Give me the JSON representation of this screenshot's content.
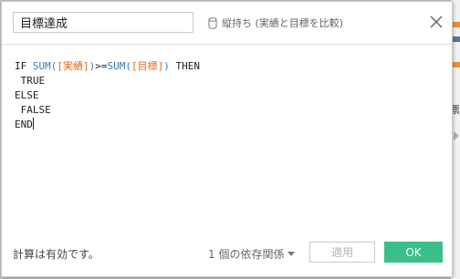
{
  "calc": {
    "name": "目標達成",
    "datasource_label": "縦持ち (実績と目標を比較)",
    "formula": {
      "line1": {
        "if": "IF",
        "sum1": "SUM(",
        "field1": "[実績]",
        "close1": ")",
        "op": ">=",
        "sum2": "SUM(",
        "field2": "[目標]",
        "close2": ")",
        "then": " THEN"
      },
      "line2": " TRUE",
      "line3": "ELSE",
      "line4": " FALSE",
      "line5": "END"
    }
  },
  "footer": {
    "status": "計算は有効です。",
    "dependencies": "1 個の依存関係",
    "apply_label": "適用",
    "ok_label": "OK"
  },
  "background": {
    "side_char": "票"
  },
  "colors": {
    "ok_button": "#3bbf8a",
    "function": "#3a78b5",
    "field": "#e06a1a"
  },
  "icons": {
    "datasource": "database-icon",
    "close": "close-icon",
    "dependencies_caret": "caret-down-icon"
  }
}
